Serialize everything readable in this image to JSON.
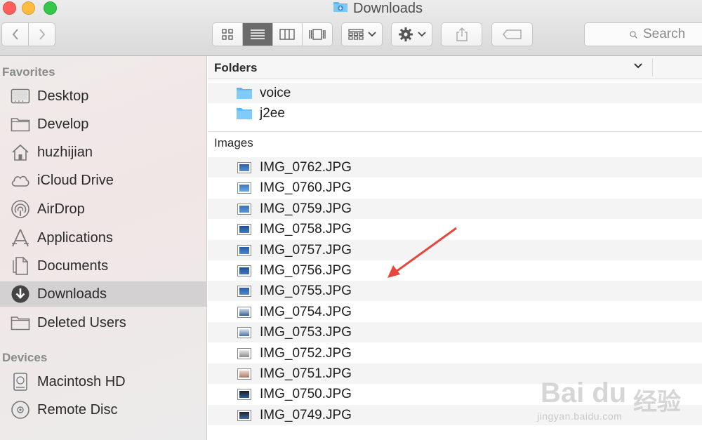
{
  "window": {
    "title": "Downloads"
  },
  "toolbar": {
    "search_placeholder": "Search",
    "view_modes": [
      "icon-view",
      "list-view",
      "column-view",
      "cover-flow-view"
    ],
    "active_view": "list-view"
  },
  "sidebar": {
    "favorites_label": "Favorites",
    "favorites": [
      {
        "label": "Desktop",
        "icon": "desktop-icon"
      },
      {
        "label": "Develop",
        "icon": "folder-icon"
      },
      {
        "label": "huzhijian",
        "icon": "home-icon"
      },
      {
        "label": "iCloud Drive",
        "icon": "cloud-icon"
      },
      {
        "label": "AirDrop",
        "icon": "airdrop-icon"
      },
      {
        "label": "Applications",
        "icon": "applications-icon"
      },
      {
        "label": "Documents",
        "icon": "documents-icon"
      },
      {
        "label": "Downloads",
        "icon": "downloads-icon",
        "selected": true
      },
      {
        "label": "Deleted Users",
        "icon": "folder-icon"
      }
    ],
    "devices_label": "Devices",
    "devices": [
      {
        "label": "Macintosh HD",
        "icon": "hard-disk-icon"
      },
      {
        "label": "Remote Disc",
        "icon": "disc-icon"
      }
    ]
  },
  "main": {
    "folders_header": "Folders",
    "folders": [
      "voice",
      "j2ee"
    ],
    "images_header": "Images",
    "images": [
      "IMG_0762.JPG",
      "IMG_0760.JPG",
      "IMG_0759.JPG",
      "IMG_0758.JPG",
      "IMG_0757.JPG",
      "IMG_0756.JPG",
      "IMG_0755.JPG",
      "IMG_0754.JPG",
      "IMG_0753.JPG",
      "IMG_0752.JPG",
      "IMG_0751.JPG",
      "IMG_0750.JPG",
      "IMG_0749.JPG"
    ]
  },
  "watermark": {
    "logo": "Bai du",
    "logo_cn": "经验",
    "url": "jingyan.baidu.com"
  },
  "colors": {
    "selection": "#d4d1d2",
    "folder": "#5ab8f5",
    "arrow": "#e8453c"
  }
}
